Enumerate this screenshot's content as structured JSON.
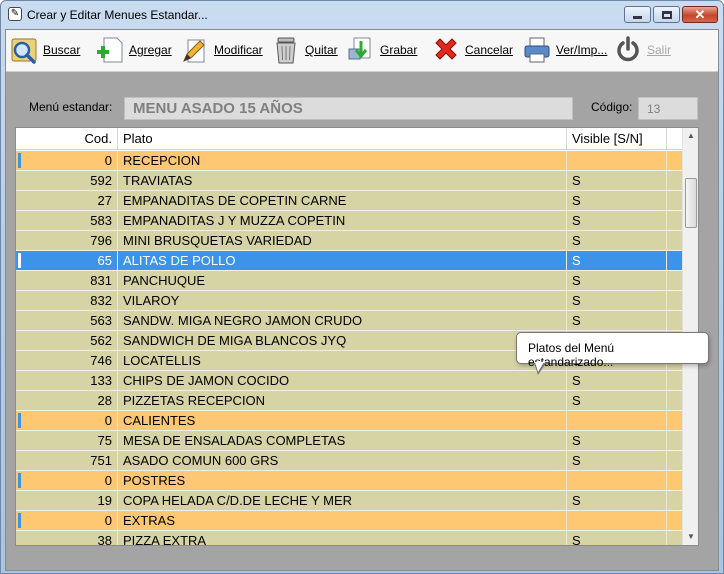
{
  "window": {
    "title": "Crear y Editar Menues Estandar...",
    "app_icon": "app-icon"
  },
  "toolbar": {
    "buttons": [
      {
        "label": "Buscar",
        "icon": "search-icon",
        "enabled": true
      },
      {
        "label": "Agregar",
        "icon": "add-document-icon",
        "enabled": true
      },
      {
        "label": "Modificar",
        "icon": "edit-pencil-icon",
        "enabled": true
      },
      {
        "label": "Quitar",
        "icon": "trash-icon",
        "enabled": true
      },
      {
        "label": "Grabar",
        "icon": "save-icon",
        "enabled": true
      },
      {
        "label": "Cancelar",
        "icon": "cancel-x-icon",
        "enabled": true
      },
      {
        "label": "Ver/Imp...",
        "icon": "printer-icon",
        "enabled": true
      },
      {
        "label": "Salir",
        "icon": "power-icon",
        "enabled": false
      }
    ]
  },
  "form": {
    "menu_label": "Menú estandar:",
    "menu_value": "MENU ASADO 15 AÑOS",
    "code_label": "Código:",
    "code_value": "13"
  },
  "grid": {
    "columns": [
      "Cod.",
      "Plato",
      "Visible [S/N]"
    ],
    "rows": [
      {
        "cod": "0",
        "plato": "RECEPCION",
        "visible": "",
        "type": "section"
      },
      {
        "cod": "592",
        "plato": "TRAVIATAS",
        "visible": "S",
        "type": "item"
      },
      {
        "cod": "27",
        "plato": "EMPANADITAS DE COPETIN CARNE",
        "visible": "S",
        "type": "item"
      },
      {
        "cod": "583",
        "plato": "EMPANADITAS J Y MUZZA COPETIN",
        "visible": "S",
        "type": "item"
      },
      {
        "cod": "796",
        "plato": "MINI BRUSQUETAS VARIEDAD",
        "visible": "S",
        "type": "item"
      },
      {
        "cod": "65",
        "plato": "ALITAS DE POLLO",
        "visible": "S",
        "type": "selected"
      },
      {
        "cod": "831",
        "plato": "PANCHUQUE",
        "visible": "S",
        "type": "item"
      },
      {
        "cod": "832",
        "plato": "VILAROY",
        "visible": "S",
        "type": "item"
      },
      {
        "cod": "563",
        "plato": "SANDW. MIGA NEGRO JAMON CRUDO",
        "visible": "S",
        "type": "item"
      },
      {
        "cod": "562",
        "plato": "SANDWICH DE MIGA BLANCOS JYQ",
        "visible": "S",
        "type": "item"
      },
      {
        "cod": "746",
        "plato": "LOCATELLIS",
        "visible": "S",
        "type": "item"
      },
      {
        "cod": "133",
        "plato": "CHIPS DE JAMON COCIDO",
        "visible": "S",
        "type": "item"
      },
      {
        "cod": "28",
        "plato": "PIZZETAS RECEPCION",
        "visible": "S",
        "type": "item"
      },
      {
        "cod": "0",
        "plato": "CALIENTES",
        "visible": "",
        "type": "section"
      },
      {
        "cod": "75",
        "plato": "MESA DE ENSALADAS COMPLETAS",
        "visible": "S",
        "type": "item"
      },
      {
        "cod": "751",
        "plato": "ASADO COMUN 600 GRS",
        "visible": "S",
        "type": "item"
      },
      {
        "cod": "0",
        "plato": "POSTRES",
        "visible": "",
        "type": "section"
      },
      {
        "cod": "19",
        "plato": "COPA HELADA C/D.DE LECHE Y MER",
        "visible": "S",
        "type": "item"
      },
      {
        "cod": "0",
        "plato": "EXTRAS",
        "visible": "",
        "type": "section"
      },
      {
        "cod": "38",
        "plato": "PIZZA EXTRA",
        "visible": "S",
        "type": "item"
      }
    ]
  },
  "tooltip": {
    "text": "Platos del Menú estandarizado..."
  },
  "colors": {
    "row_item": "#d6d3a4",
    "row_section": "#fec772",
    "row_selected": "#3b94e9",
    "window_background": "#a4a4a4"
  }
}
